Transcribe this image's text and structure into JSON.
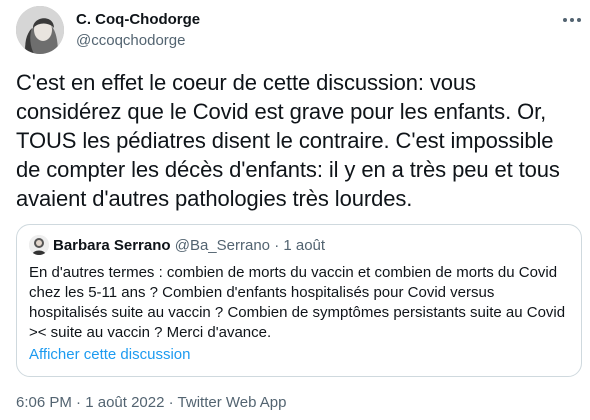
{
  "author": {
    "name": "C. Coq-Chodorge",
    "handle": "@ccoqchodorge"
  },
  "tweet": {
    "text": "C'est en effet le coeur de cette discussion: vous considérez que le Covid est grave pour les enfants. Or, TOUS les pédiatres disent le contraire. C'est impossible de compter les décès d'enfants: il y en a très peu et tous avaient d'autres pathologies très lourdes."
  },
  "quote": {
    "author_name": "Barbara Serrano",
    "author_handle": "@Ba_Serrano",
    "separator": "·",
    "date": "1 août",
    "text": "En d'autres termes : combien de morts du vaccin et combien de morts du Covid chez les 5-11 ans ? Combien d'enfants hospitalisés pour Covid versus hospitalisés suite au vaccin ? Combien de symptômes persistants  suite au Covid >< suite au vaccin ? Merci d'avance.",
    "show_thread_label": "Afficher cette discussion"
  },
  "footer": {
    "time": "6:06 PM",
    "separator": "·",
    "date": "1 août 2022",
    "app": "Twitter Web App"
  },
  "icons": {
    "more": "more-dots-icon"
  },
  "colors": {
    "link": "#1d9bf0",
    "secondary_text": "#536471",
    "border": "#cfd9de"
  }
}
